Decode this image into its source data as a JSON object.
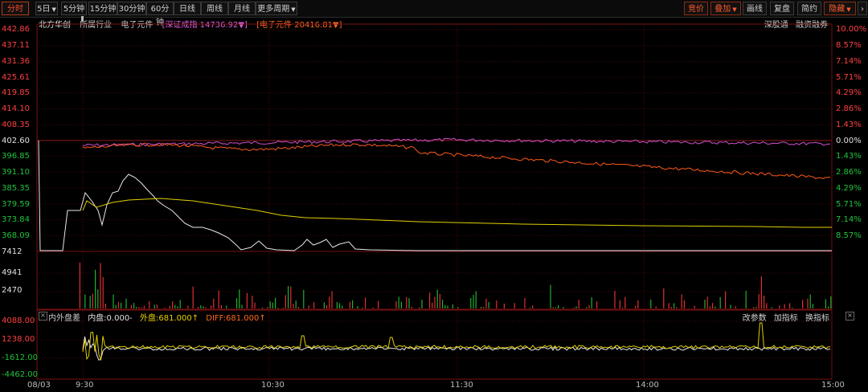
{
  "toolbar": {
    "left": [
      "分时",
      "5日",
      "5分钟",
      "15分钟",
      "30分钟",
      "60分钟",
      "日线",
      "周线",
      "月线",
      "更多周期"
    ],
    "right": [
      "竞价",
      "叠加",
      "画线",
      "复盘",
      "简约",
      "隐藏"
    ]
  },
  "legend": {
    "name": "北方华创",
    "industry_label": "所属行业",
    "industry": "电子元件",
    "idx1": "[深证成指 14736.92▼]",
    "idx2": "[电子元件 20416.81▼]"
  },
  "links": {
    "a": "深股通",
    "b": "融资融券"
  },
  "price_axis": [
    "442.86",
    "437.11",
    "431.36",
    "425.61",
    "419.85",
    "414.10",
    "408.35",
    "402.60",
    "396.85",
    "391.10",
    "385.35",
    "379.59",
    "373.84",
    "368.09"
  ],
  "pct_axis": [
    "10.00%",
    "8.57%",
    "7.14%",
    "5.71%",
    "4.29%",
    "2.86%",
    "1.43%",
    "0.00%",
    "1.43%",
    "2.86%",
    "4.29%",
    "5.71%",
    "7.14%",
    "8.57%"
  ],
  "volume_axis": [
    "7412",
    "4941",
    "2470"
  ],
  "sub_axis": [
    "4088.00",
    "1238.00",
    "-1612.00",
    "-4462.00"
  ],
  "subpanel": {
    "title": "内外盘差",
    "inner": "内盘:0.000-",
    "outer": "外盘:681.000↑",
    "diff": "DIFF:681.000↑",
    "tools": [
      "改参数",
      "加指标",
      "换指标"
    ]
  },
  "time_axis": [
    "08/03",
    "9:30",
    "10:30",
    "11:30",
    "14:00",
    "15:00"
  ],
  "colors": {
    "price": "#e8e8e8",
    "avg": "#e0d000",
    "index1": "#d050d0",
    "index2": "#ff5a1a",
    "up": "#e03030",
    "down": "#20b030"
  }
}
